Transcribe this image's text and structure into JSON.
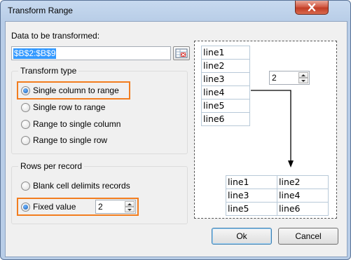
{
  "window": {
    "title": "Transform Range"
  },
  "data_label": "Data to be transformed:",
  "range_value": "$B$2:$B$9",
  "transform_type": {
    "title": "Transform type",
    "options": [
      {
        "label": "Single column to range",
        "checked": true
      },
      {
        "label": "Single row to range",
        "checked": false
      },
      {
        "label": "Range to single column",
        "checked": false
      },
      {
        "label": "Range to single row",
        "checked": false
      }
    ]
  },
  "rows_per_record": {
    "title": "Rows per record",
    "blank_label": "Blank cell delimits records",
    "fixed_label": "Fixed value",
    "fixed_value": "2"
  },
  "preview": {
    "source": [
      "line1",
      "line2",
      "line3",
      "line4",
      "line5",
      "line6"
    ],
    "spin_value": "2",
    "result": [
      [
        "line1",
        "line2"
      ],
      [
        "line3",
        "line4"
      ],
      [
        "line5",
        "line6"
      ]
    ]
  },
  "buttons": {
    "ok": "Ok",
    "cancel": "Cancel"
  },
  "colors": {
    "highlight": "#f27d1f",
    "selection": "#3399ff",
    "close": "#c13d26"
  }
}
